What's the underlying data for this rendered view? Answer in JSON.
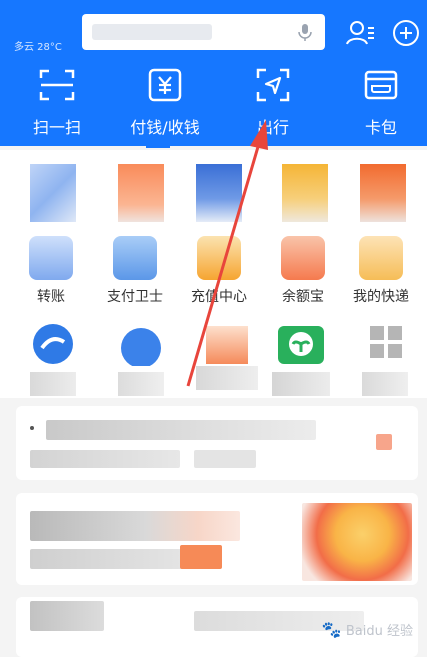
{
  "header": {
    "weather": "多云 28°C",
    "search_placeholder": ""
  },
  "top_icons": [
    "contacts-icon",
    "add-icon"
  ],
  "shortcuts": [
    {
      "label": "扫一扫",
      "icon": "scan-icon"
    },
    {
      "label": "付钱/收钱",
      "icon": "pay-icon"
    },
    {
      "label": "出行",
      "icon": "travel-icon"
    },
    {
      "label": "卡包",
      "icon": "card-wallet-icon"
    }
  ],
  "apps_row2": [
    {
      "label": "转账"
    },
    {
      "label": "支付卫士"
    },
    {
      "label": "充值中心"
    },
    {
      "label": "余额宝"
    },
    {
      "label": "我的快递"
    }
  ],
  "watermark": {
    "text": "Baidu 经验"
  },
  "colors": {
    "brand": "#1677ff",
    "annotation": "#e8453c"
  }
}
